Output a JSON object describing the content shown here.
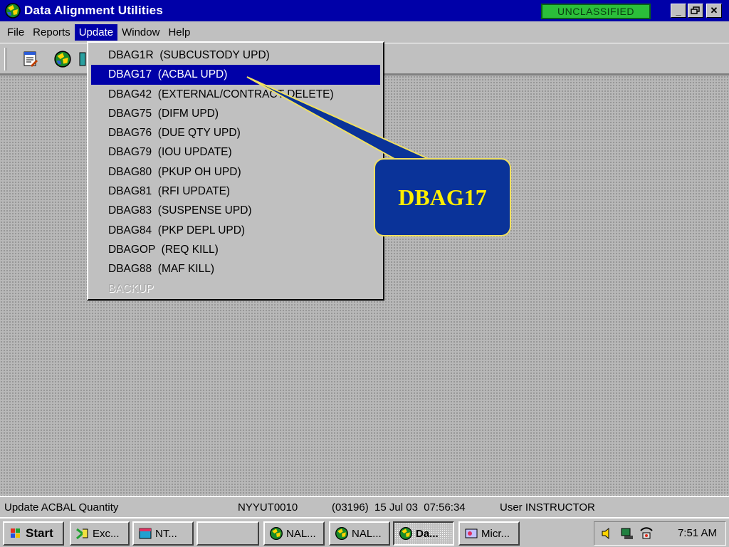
{
  "window": {
    "title": "Data Alignment Utilities",
    "classification": "UNCLASSIFIED",
    "minimize": "_",
    "maximize": "▫",
    "close": "✕"
  },
  "menubar": {
    "items": [
      {
        "label": "File",
        "accel": "F"
      },
      {
        "label": "Reports",
        "accel": "R"
      },
      {
        "label": "Update",
        "accel": "U"
      },
      {
        "label": "Window",
        "accel": "W"
      },
      {
        "label": "Help",
        "accel": "H"
      }
    ]
  },
  "toolbar": {
    "icons": [
      "report-icon",
      "globe-icon",
      "partial-icon"
    ]
  },
  "dropdown": {
    "items": [
      "DBAG1R  (SUBCUSTODY UPD)",
      "DBAG17  (ACBAL UPD)",
      "DBAG42  (EXTERNAL/CONTRACT DELETE)",
      "DBAG75  (DIFM UPD)",
      "DBAG76  (DUE QTY UPD)",
      "DBAG79  (IOU UPDATE)",
      "DBAG80  (PKUP OH UPD)",
      "DBAG81  (RFI UPDATE)",
      "DBAG83  (SUSPENSE UPD)",
      "DBAG84  (PKP DEPL UPD)",
      "DBAGOP  (REQ KILL)",
      "DBAG88  (MAF KILL)",
      "BACKUP"
    ],
    "selected_index": 1,
    "disabled_index": 12
  },
  "callout": {
    "label": "DBAG17",
    "bg_color": "#0a3399",
    "text_color": "#ffee00"
  },
  "statusbar": {
    "message": "Update ACBAL Quantity",
    "terminal": "NYYUT0010",
    "session": "(03196)  15 Jul 03  07:56:34",
    "user": "User INSTRUCTOR"
  },
  "taskbar": {
    "start_label": "Start",
    "buttons": [
      "Exc...",
      "NT...",
      "",
      "NAL...",
      "NAL...",
      "Da...",
      "Micr..."
    ],
    "clock": "7:51 AM"
  }
}
